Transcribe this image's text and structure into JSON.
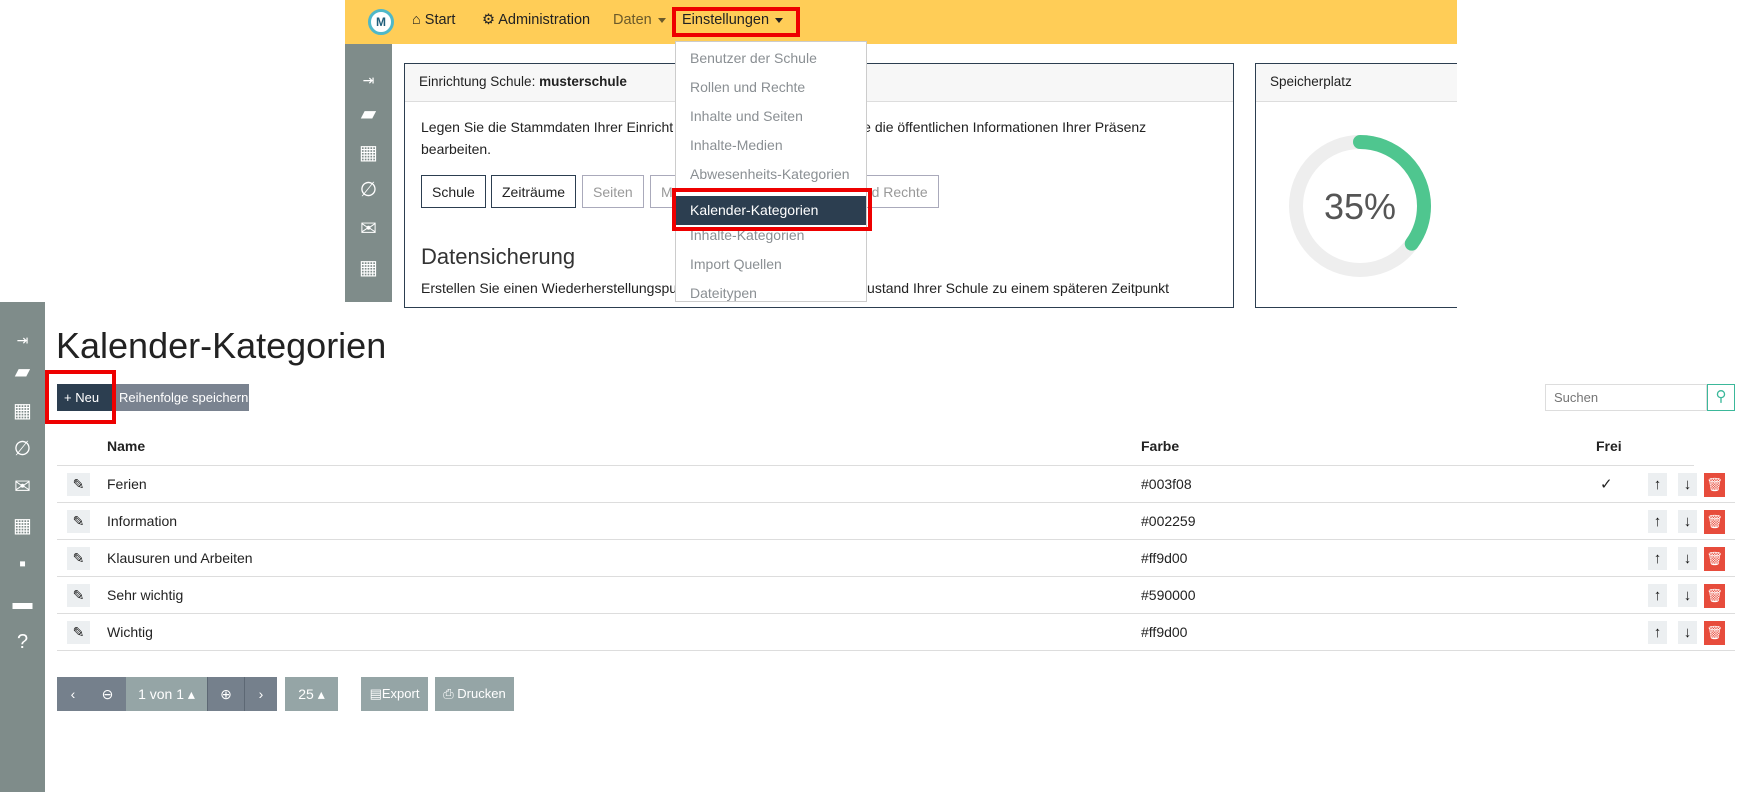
{
  "topnav": {
    "logo": "M",
    "start": "Start",
    "administration": "Administration",
    "daten": "Daten",
    "einstellungen": "Einstellungen"
  },
  "dropdown": {
    "items": [
      "Benutzer der Schule",
      "Rollen und Rechte",
      "Inhalte und Seiten",
      "Inhalte-Medien",
      "Abwesenheits-Kategorien",
      "Kalender-Kategorien",
      "Inhalte-Kategorien",
      "Import Quellen",
      "Dateitypen"
    ],
    "active": "Kalender-Kategorien"
  },
  "card_school": {
    "header_label": "Einrichtung Schule: ",
    "header_value": "musterschule",
    "text_left": "Legen Sie die Stammdaten Ihrer Einricht",
    "text_right": "e die öffentlichen Informationen Ihrer Präsenz",
    "text_line2": "bearbeiten.",
    "buttons": [
      "Schule",
      "Zeiträume",
      "Seiten",
      "M",
      "und Rechte"
    ],
    "backup_title": "Datensicherung",
    "backup_left": "Erstellen Sie einen Wiederherstellungspu",
    "backup_right": "ustand Ihrer Schule zu einem späteren Zeitpunkt"
  },
  "card_storage": {
    "title": "Speicherplatz",
    "percent": 35,
    "percent_label": "35%",
    "color": "#4fc68f"
  },
  "page": {
    "title": "Kalender-Kategorien",
    "new_button": "+ Neu",
    "save_order_button": "Reihenfolge speichern",
    "search_placeholder": "Suchen"
  },
  "table": {
    "headers": {
      "name": "Name",
      "farbe": "Farbe",
      "frei": "Frei"
    },
    "rows": [
      {
        "name": "Ferien",
        "farbe": "#003f08",
        "frei": "✓"
      },
      {
        "name": "Information",
        "farbe": "#002259",
        "frei": ""
      },
      {
        "name": "Klausuren und Arbeiten",
        "farbe": "#ff9d00",
        "frei": ""
      },
      {
        "name": "Sehr wichtig",
        "farbe": "#590000",
        "frei": ""
      },
      {
        "name": "Wichtig",
        "farbe": "#ff9d00",
        "frei": ""
      }
    ]
  },
  "pagination": {
    "page_label": "1 von 1",
    "page_size": "25",
    "export": "Export",
    "print": "Drucken"
  },
  "colors": {
    "accent_yellow": "#ffcd57",
    "primary_dark": "#2c3e50",
    "delete_red": "#e74c3c",
    "highlight_red": "#e00000"
  }
}
